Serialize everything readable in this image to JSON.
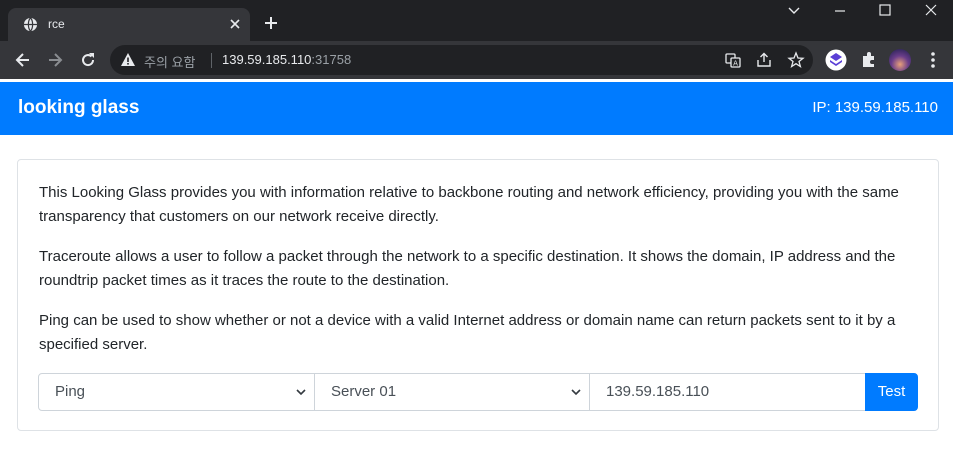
{
  "browser": {
    "tab_title": "rce",
    "security_warning": "주의 요함",
    "url_host": "139.59.185.110",
    "url_port": ":31758"
  },
  "navbar": {
    "brand": "looking glass",
    "ip_label": "IP: 139.59.185.110"
  },
  "content": {
    "paragraphs": [
      "This Looking Glass provides you with information relative to backbone routing and network efficiency, providing you with the same transparency that customers on our network receive directly.",
      "Traceroute allows a user to follow a packet through the network to a specific destination. It shows the domain, IP address and the roundtrip packet times as it traces the route to the destination.",
      "Ping can be used to show whether or not a device with a valid Internet address or domain name can return packets sent to it by a specified server."
    ]
  },
  "form": {
    "tool_selected": "Ping",
    "server_selected": "Server 01",
    "target_value": "139.59.185.110",
    "submit_label": "Test"
  },
  "colors": {
    "accent": "#007bff",
    "chrome_dark": "#202124",
    "chrome_tab": "#35363a"
  },
  "icons": [
    "globe-icon",
    "close-icon",
    "plus-icon",
    "minimize-icon",
    "maximize-icon",
    "window-close-icon",
    "chevron-down-icon",
    "back-icon",
    "forward-icon",
    "reload-icon",
    "warning-icon",
    "translate-icon",
    "share-icon",
    "star-icon",
    "extension-icon",
    "puzzle-icon",
    "avatar",
    "menu-dots-icon"
  ]
}
